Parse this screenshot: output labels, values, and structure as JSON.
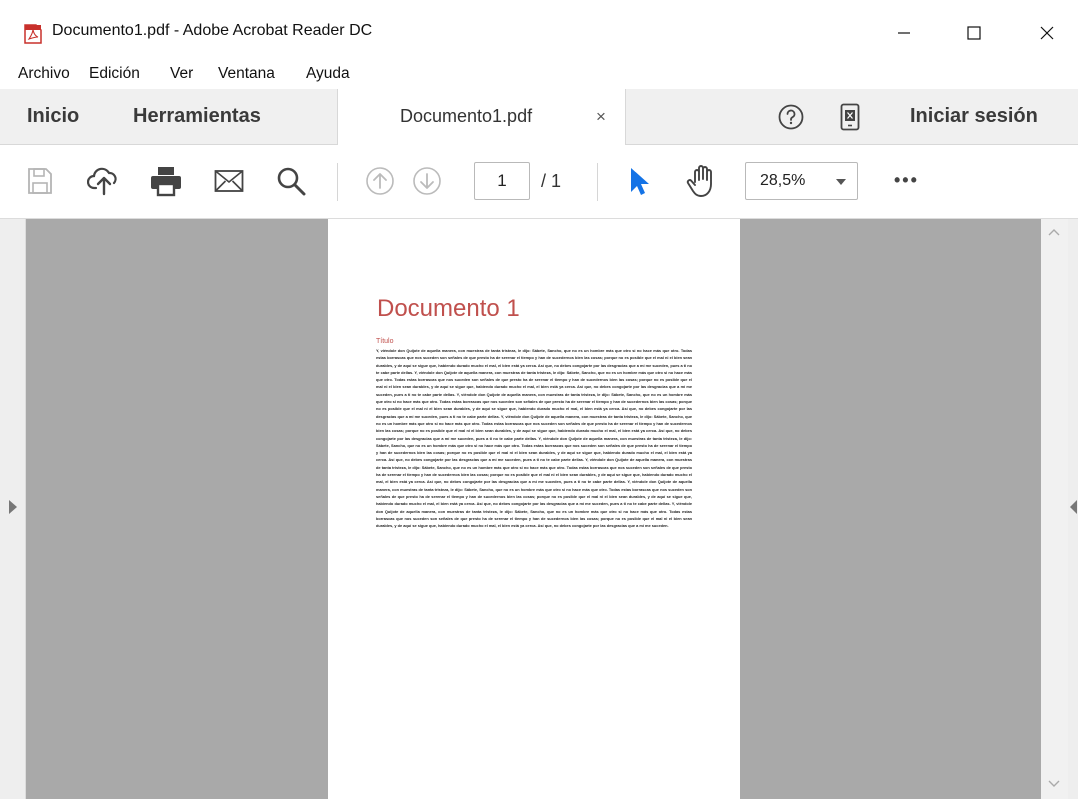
{
  "window": {
    "title": "Documento1.pdf - Adobe Acrobat Reader DC",
    "minimize_icon": "minimize-icon",
    "maximize_icon": "maximize-icon",
    "close_icon": "close-icon"
  },
  "menu": [
    "Archivo",
    "Edición",
    "Ver",
    "Ventana",
    "Ayuda"
  ],
  "tabs": {
    "home": "Inicio",
    "tools": "Herramientas",
    "document": "Documento1.pdf",
    "document_close": "×",
    "sign_in": "Iniciar sesión"
  },
  "toolbar": {
    "icons": [
      "save-icon",
      "upload-cloud-icon",
      "print-icon",
      "email-icon",
      "search-icon",
      "previous-page-icon",
      "next-page-icon",
      "select-cursor-icon",
      "hand-tool-icon",
      "more-tools-icon"
    ],
    "current_page": "1",
    "total_pages": "/ 1",
    "zoom": "28,5%",
    "more": "•••"
  },
  "colors": {
    "accent_blue": "#1473e6",
    "heading_red": "#c0504d",
    "canvas_gray": "#a9a9a9"
  },
  "document": {
    "heading": "Documento 1",
    "subtitle": "Título",
    "body": "Y, viéndole don Quijote de aquella manera, con muestras de tanta tristeza, le dijo: Sábete, Sancho, que no es un hombre más que otro si no hace más que otro. Todas estas borrascas que nos suceden son señales de que presto ha de serenar el tiempo y han de sucedernos bien las cosas; porque no es posible que el mal ni el bien sean durables, y de aquí se sigue que, habiendo durado mucho el mal, el bien está ya cerca. Así que, no debes congojarte por las desgracias que a mí me suceden, pues a ti no te cabe parte dellas. Y, viéndole don Quijote de aquella manera, con muestras de tanta tristeza, le dijo: Sábete, Sancho, que no es un hombre más que otro si no hace más que otro. Todas estas borrascas que nos suceden son señales de que presto ha de serenar el tiempo y han de sucedernos bien las cosas; porque no es posible que el mal ni el bien sean durables, y de aquí se sigue que, habiendo durado mucho el mal, el bien está ya cerca. Así que, no debes congojarte por las desgracias que a mí me suceden, pues a ti no te cabe parte dellas. Y, viéndole don Quijote de aquella manera, con muestras de tanta tristeza, le dijo: Sábete, Sancho, que no es un hombre más que otro si no hace más que otro. Todas estas borrascas que nos suceden son señales de que presto ha de serenar el tiempo y han de sucedernos bien las cosas; porque no es posible que el mal ni el bien sean durables, y de aquí se sigue que, habiendo durado mucho el mal, el bien está ya cerca. Así que, no debes congojarte por las desgracias que a mí me suceden, pues a ti no te cabe parte dellas. Y, viéndole don Quijote de aquella manera, con muestras de tanta tristeza, le dijo: Sábete, Sancho, que no es un hombre más que otro si no hace más que otro. Todas estas borrascas que nos suceden son señales de que presto ha de serenar el tiempo y han de sucedernos bien las cosas; porque no es posible que el mal ni el bien sean durables, y de aquí se sigue que, habiendo durado mucho el mal, el bien está ya cerca. Así que, no debes congojarte por las desgracias que a mí me suceden, pues a ti no te cabe parte dellas. Y, viéndole don Quijote de aquella manera, con muestras de tanta tristeza, le dijo: Sábete, Sancho, que no es un hombre más que otro si no hace más que otro. Todas estas borrascas que nos suceden son señales de que presto ha de serenar el tiempo y han de sucedernos bien las cosas; porque no es posible que el mal ni el bien sean durables, y de aquí se sigue que, habiendo durado mucho el mal, el bien está ya cerca. Así que, no debes congojarte por las desgracias que a mí me suceden, pues a ti no te cabe parte dellas. Y, viéndole don Quijote de aquella manera, con muestras de tanta tristeza, le dijo: Sábete, Sancho, que no es un hombre más que otro si no hace más que otro. Todas estas borrascas que nos suceden son señales de que presto ha de serenar el tiempo y han de sucedernos bien las cosas; porque no es posible que el mal ni el bien sean durables, y de aquí se sigue que, habiendo durado mucho el mal, el bien está ya cerca. Así que, no debes congojarte por las desgracias que a mí me suceden, pues a ti no te cabe parte dellas. Y, viéndole don Quijote de aquella manera, con muestras de tanta tristeza, le dijo: Sábete, Sancho, que no es un hombre más que otro si no hace más que otro. Todas estas borrascas que nos suceden son señales de que presto ha de serenar el tiempo y han de sucedernos bien las cosas; porque no es posible que el mal ni el bien sean durables, y de aquí se sigue que, habiendo durado mucho el mal, el bien está ya cerca. Así que, no debes congojarte por las desgracias que a mí me suceden, pues a ti no te cabe parte dellas. Y, viéndole don Quijote de aquella manera, con muestras de tanta tristeza, le dijo: Sábete, Sancho, que no es un hombre más que otro si no hace más que otro. Todas estas borrascas que nos suceden son señales de que presto ha de serenar el tiempo y han de sucedernos bien las cosas; porque no es posible que el mal ni el bien sean durables, y de aquí se sigue que, habiendo durado mucho el mal, el bien está ya cerca. Así que, no debes congojarte por las desgracias que a mí me suceden."
  }
}
